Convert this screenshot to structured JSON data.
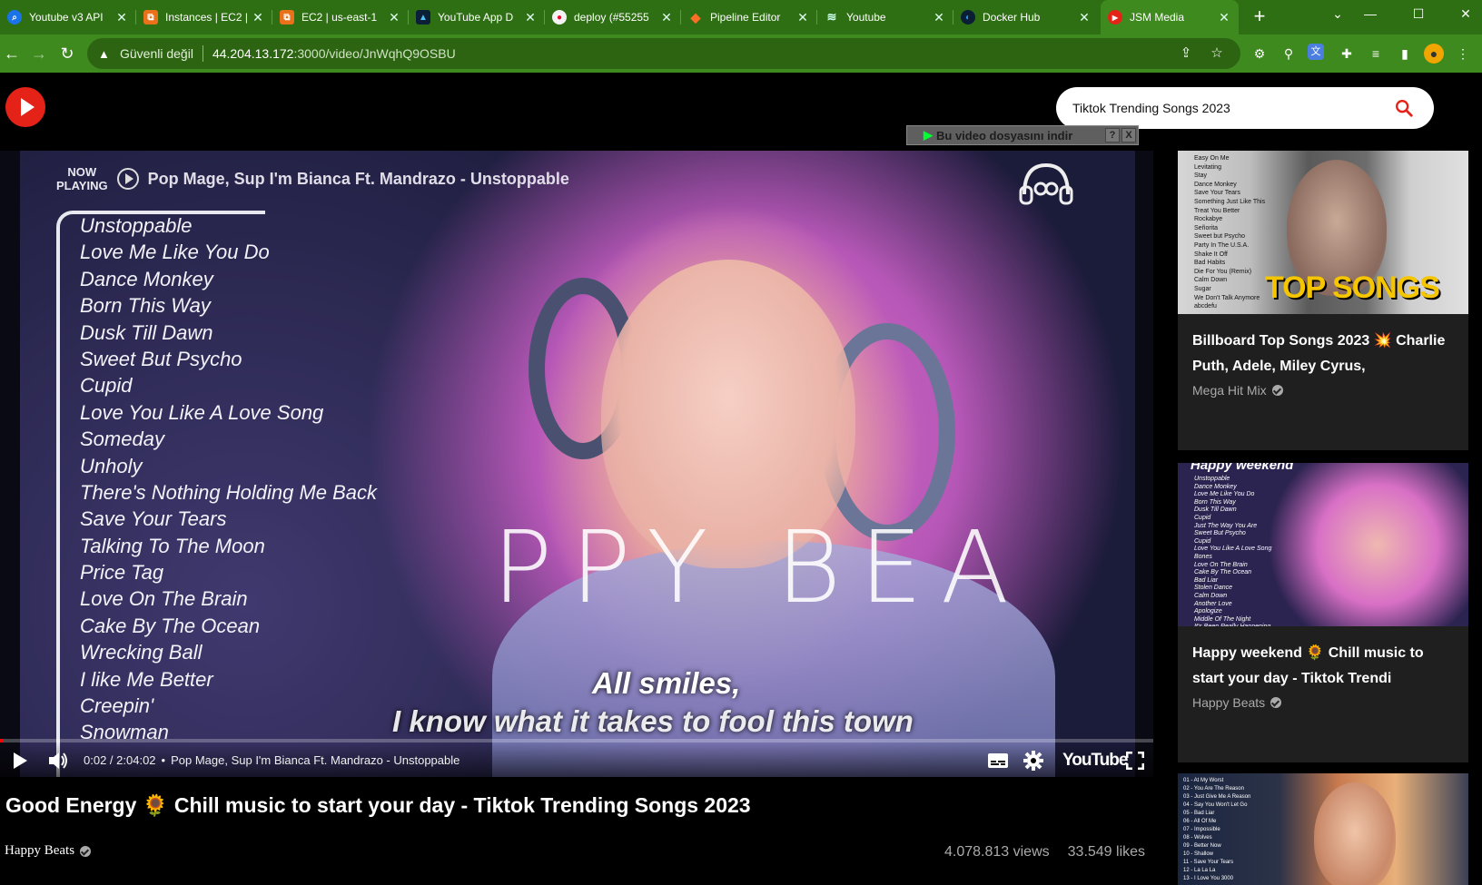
{
  "browser": {
    "tabs": [
      {
        "title": "Youtube v3 API",
        "favicon": "search-icon",
        "active": false
      },
      {
        "title": "Instances | EC2 |",
        "favicon": "aws-icon",
        "active": false
      },
      {
        "title": "EC2 | us-east-1",
        "favicon": "aws-icon",
        "active": false
      },
      {
        "title": "YouTube App D",
        "favicon": "app-icon",
        "active": false
      },
      {
        "title": "deploy (#55255",
        "favicon": "github-icon",
        "active": false
      },
      {
        "title": "Pipeline Editor",
        "favicon": "gitlab-icon",
        "active": false
      },
      {
        "title": "Youtube",
        "favicon": "vercel-icon",
        "active": false
      },
      {
        "title": "Docker Hub",
        "favicon": "docker-icon",
        "active": false
      },
      {
        "title": "JSM Media",
        "favicon": "youtube-icon",
        "active": true
      }
    ],
    "security_label": "Güvenli değil",
    "url_host": "44.204.13.172",
    "url_path": ":3000/video/JnWqhQ9OSBU",
    "colors": {
      "frame": "#2f6f13",
      "toolbar": "#3f8a1f"
    }
  },
  "app": {
    "search_value": "Tiktok Trending Songs 2023",
    "search_icon": "magnifier-icon",
    "logo_color": "#e52218"
  },
  "player": {
    "now_playing_label_1": "NOW",
    "now_playing_label_2": "PLAYING",
    "now_playing_song": "Pop Mage, Sup I'm Bianca Ft. Mandrazo - Unstoppable",
    "playlist": [
      "Unstoppable",
      "Love Me Like You Do",
      "Dance Monkey",
      "Born This Way",
      "Dusk Till Dawn",
      "Sweet But Psycho",
      "Cupid",
      "Love You Like A Love Song",
      "Someday",
      "Unholy",
      "There's Nothing Holding Me Back",
      "Save Your Tears",
      "Talking To The Moon",
      "Price Tag",
      "Love On The Brain",
      "Cake By The Ocean",
      "Wrecking Ball",
      "I like Me Better",
      "Creepin'",
      "Snowman"
    ],
    "overlay_title": "PPY  BEA",
    "lyric_line_1": "All smiles,",
    "lyric_line_2": "I know what it takes to fool this town",
    "download_label": "Bu video dosyasını indir",
    "download_help": "?",
    "download_close": "X",
    "current_time": "0:02",
    "duration": "2:04:02",
    "chapter_title": "Pop Mage, Sup I'm Bianca Ft. Mandrazo - Unstoppable",
    "youtube_wordmark": "YouTube",
    "progress_fraction": 0.0003,
    "progress_color": "#ff0000"
  },
  "video": {
    "title_prefix": "Good Energy",
    "title_suffix": "Chill music to start your day - Tiktok Trending Songs 2023",
    "title_emoji": "🌻",
    "channel": "Happy Beats",
    "views": "4.078.813 views",
    "likes": "33.549 likes"
  },
  "related": [
    {
      "title": "Billboard Top Songs 2023 💥 Charlie Puth, Adele, Miley Cyrus,",
      "channel": "Mega Hit Mix",
      "thumb_text": "TOP SONGS",
      "thumb_list": [
        "Easy On Me",
        "Levitating",
        "Stay",
        "Dance Monkey",
        "Save Your Tears",
        "Something Just Like This",
        "Treat You Better",
        "Rockabye",
        "Señorita",
        "Sweet but Psycho",
        "Party In The U.S.A.",
        "Shake It Off",
        "Bad Habits",
        "Die For You (Remix)",
        "Calm Down",
        "Sugar",
        "We Don't Talk Anymore",
        "abcdefu"
      ]
    },
    {
      "title": "Happy weekend 🌻 Chill music to start your day - Tiktok Trendi",
      "channel": "Happy Beats",
      "thumb_text": "Happy weekend",
      "thumb_list": [
        "Unstoppable",
        "Dance Monkey",
        "Love Me Like You Do",
        "Born This Way",
        "Dusk Till Dawn",
        "Cupid",
        "Just The Way You Are",
        "Sweet But Psycho",
        "Cupid",
        "Love You Like A Love Song",
        "Bones",
        "Love On The Brain",
        "Cake By The Ocean",
        "Bad Liar",
        "Stolen Dance",
        "Calm Down",
        "Another Love",
        "Apologize",
        "Middle Of The Night",
        "It's Been Really Happening"
      ]
    },
    {
      "title": "",
      "channel": "",
      "thumb_list": [
        "01 - At My Worst",
        "02 - You Are The Reason",
        "03 - Just Give Me A Reason",
        "04 - Say You Won't Let Go",
        "05 - Bad Liar",
        "06 - All Of Me",
        "07 - Impossible",
        "08 - Wolves",
        "09 - Better Now",
        "10 - Shallow",
        "11 - Save Your Tears",
        "12 - La La La",
        "13 - I Love You 3000"
      ]
    }
  ]
}
